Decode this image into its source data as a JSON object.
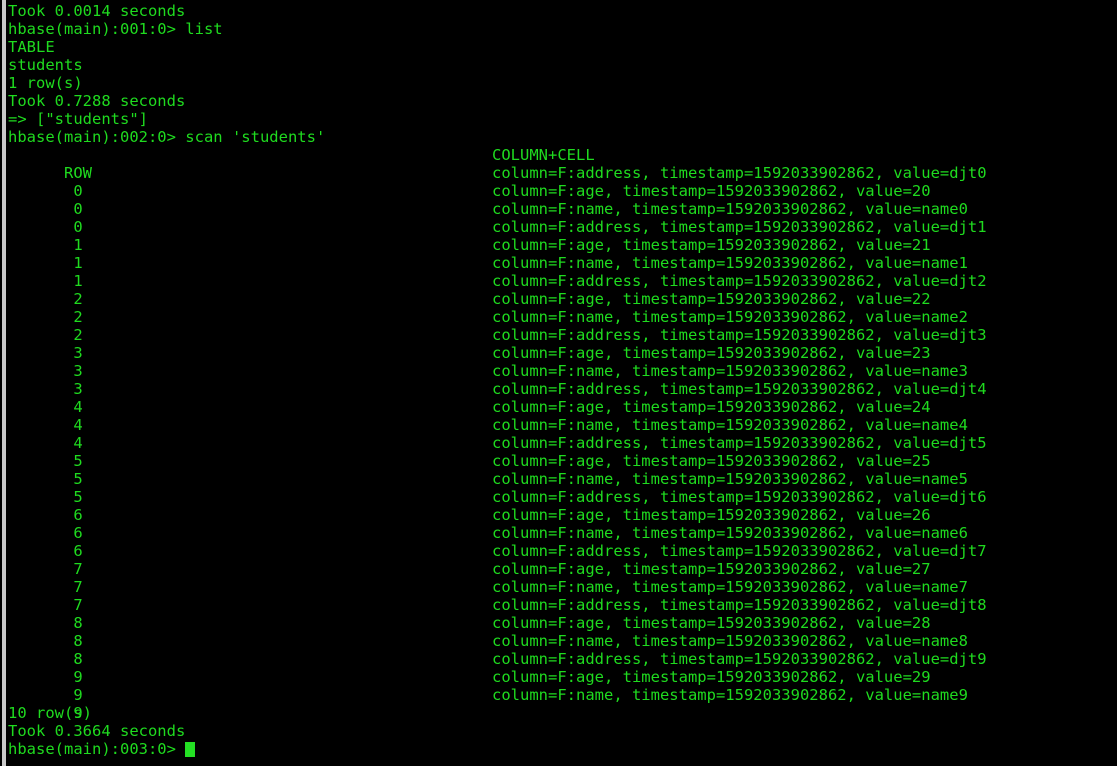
{
  "terminal": {
    "app": "HBase Shell",
    "foreground_color": "#1fdb1f",
    "background_color": "#000000",
    "cursor_color": "#24e024",
    "border_color": "#c9c9c9"
  },
  "preamble": [
    "Took 0.0014 seconds",
    "hbase(main):001:0> list",
    "TABLE",
    "students",
    "1 row(s)",
    "Took 0.7288 seconds",
    "=> [\"students\"]",
    "hbase(main):002:0> scan 'students'"
  ],
  "scan_header": {
    "row_label": "ROW",
    "cell_label": "COLUMN+CELL"
  },
  "scan_rows": [
    {
      "row": " 0",
      "cell": "column=F:address, timestamp=1592033902862, value=djt0"
    },
    {
      "row": " 0",
      "cell": "column=F:age, timestamp=1592033902862, value=20"
    },
    {
      "row": " 0",
      "cell": "column=F:name, timestamp=1592033902862, value=name0"
    },
    {
      "row": " 1",
      "cell": "column=F:address, timestamp=1592033902862, value=djt1"
    },
    {
      "row": " 1",
      "cell": "column=F:age, timestamp=1592033902862, value=21"
    },
    {
      "row": " 1",
      "cell": "column=F:name, timestamp=1592033902862, value=name1"
    },
    {
      "row": " 2",
      "cell": "column=F:address, timestamp=1592033902862, value=djt2"
    },
    {
      "row": " 2",
      "cell": "column=F:age, timestamp=1592033902862, value=22"
    },
    {
      "row": " 2",
      "cell": "column=F:name, timestamp=1592033902862, value=name2"
    },
    {
      "row": " 3",
      "cell": "column=F:address, timestamp=1592033902862, value=djt3"
    },
    {
      "row": " 3",
      "cell": "column=F:age, timestamp=1592033902862, value=23"
    },
    {
      "row": " 3",
      "cell": "column=F:name, timestamp=1592033902862, value=name3"
    },
    {
      "row": " 4",
      "cell": "column=F:address, timestamp=1592033902862, value=djt4"
    },
    {
      "row": " 4",
      "cell": "column=F:age, timestamp=1592033902862, value=24"
    },
    {
      "row": " 4",
      "cell": "column=F:name, timestamp=1592033902862, value=name4"
    },
    {
      "row": " 5",
      "cell": "column=F:address, timestamp=1592033902862, value=djt5"
    },
    {
      "row": " 5",
      "cell": "column=F:age, timestamp=1592033902862, value=25"
    },
    {
      "row": " 5",
      "cell": "column=F:name, timestamp=1592033902862, value=name5"
    },
    {
      "row": " 6",
      "cell": "column=F:address, timestamp=1592033902862, value=djt6"
    },
    {
      "row": " 6",
      "cell": "column=F:age, timestamp=1592033902862, value=26"
    },
    {
      "row": " 6",
      "cell": "column=F:name, timestamp=1592033902862, value=name6"
    },
    {
      "row": " 7",
      "cell": "column=F:address, timestamp=1592033902862, value=djt7"
    },
    {
      "row": " 7",
      "cell": "column=F:age, timestamp=1592033902862, value=27"
    },
    {
      "row": " 7",
      "cell": "column=F:name, timestamp=1592033902862, value=name7"
    },
    {
      "row": " 8",
      "cell": "column=F:address, timestamp=1592033902862, value=djt8"
    },
    {
      "row": " 8",
      "cell": "column=F:age, timestamp=1592033902862, value=28"
    },
    {
      "row": " 8",
      "cell": "column=F:name, timestamp=1592033902862, value=name8"
    },
    {
      "row": " 9",
      "cell": "column=F:address, timestamp=1592033902862, value=djt9"
    },
    {
      "row": " 9",
      "cell": "column=F:age, timestamp=1592033902862, value=29"
    },
    {
      "row": " 9",
      "cell": "column=F:name, timestamp=1592033902862, value=name9"
    }
  ],
  "footer": [
    "10 row(s)",
    "Took 0.3664 seconds"
  ],
  "prompt": {
    "text": "hbase(main):003:0> ",
    "cursor": ""
  }
}
